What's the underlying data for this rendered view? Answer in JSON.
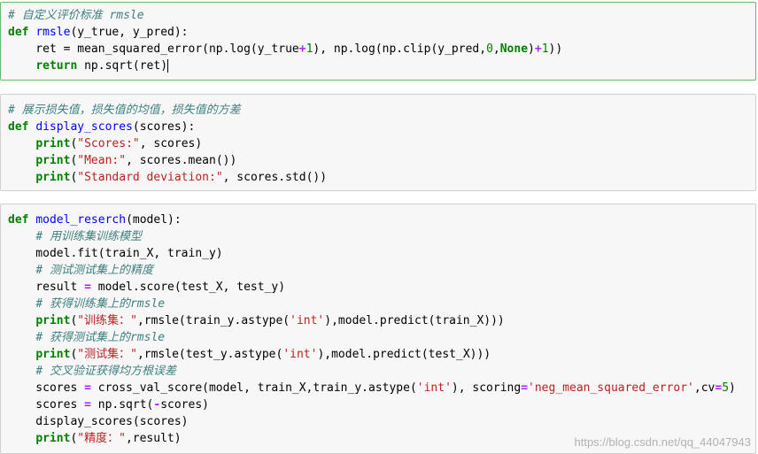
{
  "cells": [
    {
      "lines": [
        [
          {
            "t": "cm",
            "v": "# 自定义评价标准 rmsle"
          }
        ],
        [
          {
            "t": "kw",
            "v": "def"
          },
          {
            "t": "p",
            "v": " "
          },
          {
            "t": "def",
            "v": "rmsle"
          },
          {
            "t": "p",
            "v": "(y_true, y_pred):"
          }
        ],
        [
          {
            "t": "p",
            "v": "    ret = mean_squared_error(np.log(y_true"
          },
          {
            "t": "op",
            "v": "+"
          },
          {
            "t": "num",
            "v": "1"
          },
          {
            "t": "p",
            "v": "), np.log(np.clip(y_pred,"
          },
          {
            "t": "num",
            "v": "0"
          },
          {
            "t": "p",
            "v": ","
          },
          {
            "t": "kw",
            "v": "None"
          },
          {
            "t": "p",
            "v": ")"
          },
          {
            "t": "op",
            "v": "+"
          },
          {
            "t": "num",
            "v": "1"
          },
          {
            "t": "p",
            "v": "))"
          }
        ],
        [
          {
            "t": "p",
            "v": "    "
          },
          {
            "t": "kw",
            "v": "return"
          },
          {
            "t": "p",
            "v": " np.sqrt(ret)"
          }
        ]
      ]
    },
    {
      "lines": [
        [
          {
            "t": "cm",
            "v": "# 展示损失值，损失值的均值，损失值的方差"
          }
        ],
        [
          {
            "t": "kw",
            "v": "def"
          },
          {
            "t": "p",
            "v": " "
          },
          {
            "t": "def",
            "v": "display_scores"
          },
          {
            "t": "p",
            "v": "(scores):"
          }
        ],
        [
          {
            "t": "p",
            "v": "    "
          },
          {
            "t": "kw",
            "v": "print"
          },
          {
            "t": "p",
            "v": "("
          },
          {
            "t": "str",
            "v": "\"Scores:\""
          },
          {
            "t": "p",
            "v": ", scores)"
          }
        ],
        [
          {
            "t": "p",
            "v": "    "
          },
          {
            "t": "kw",
            "v": "print"
          },
          {
            "t": "p",
            "v": "("
          },
          {
            "t": "str",
            "v": "\"Mean:\""
          },
          {
            "t": "p",
            "v": ", scores.mean())"
          }
        ],
        [
          {
            "t": "p",
            "v": "    "
          },
          {
            "t": "kw",
            "v": "print"
          },
          {
            "t": "p",
            "v": "("
          },
          {
            "t": "str",
            "v": "\"Standard deviation:\""
          },
          {
            "t": "p",
            "v": ", scores.std())"
          }
        ]
      ]
    },
    {
      "lines": [
        [
          {
            "t": "kw",
            "v": "def"
          },
          {
            "t": "p",
            "v": " "
          },
          {
            "t": "def",
            "v": "model_reserch"
          },
          {
            "t": "p",
            "v": "(model):"
          }
        ],
        [
          {
            "t": "p",
            "v": "    "
          },
          {
            "t": "cm",
            "v": "# 用训练集训练模型"
          }
        ],
        [
          {
            "t": "p",
            "v": "    model.fit(train_X, train_y)"
          }
        ],
        [
          {
            "t": "p",
            "v": "    "
          },
          {
            "t": "cm",
            "v": "# 测试测试集上的精度"
          }
        ],
        [
          {
            "t": "p",
            "v": "    result "
          },
          {
            "t": "op",
            "v": "="
          },
          {
            "t": "p",
            "v": " model.score(test_X, test_y)"
          }
        ],
        [
          {
            "t": "p",
            "v": "    "
          },
          {
            "t": "cm",
            "v": "# 获得训练集上的rmsle"
          }
        ],
        [
          {
            "t": "p",
            "v": "    "
          },
          {
            "t": "kw",
            "v": "print"
          },
          {
            "t": "p",
            "v": "("
          },
          {
            "t": "str",
            "v": "\"训练集：\""
          },
          {
            "t": "p",
            "v": ",rmsle(train_y.astype("
          },
          {
            "t": "str",
            "v": "'int'"
          },
          {
            "t": "p",
            "v": "),model.predict(train_X)))"
          }
        ],
        [
          {
            "t": "p",
            "v": "    "
          },
          {
            "t": "cm",
            "v": "# 获得测试集上的rmsle"
          }
        ],
        [
          {
            "t": "p",
            "v": "    "
          },
          {
            "t": "kw",
            "v": "print"
          },
          {
            "t": "p",
            "v": "("
          },
          {
            "t": "str",
            "v": "\"测试集：\""
          },
          {
            "t": "p",
            "v": ",rmsle(test_y.astype("
          },
          {
            "t": "str",
            "v": "'int'"
          },
          {
            "t": "p",
            "v": "),model.predict(test_X)))"
          }
        ],
        [
          {
            "t": "p",
            "v": "    "
          },
          {
            "t": "cm",
            "v": "# 交叉验证获得均方根误差"
          }
        ],
        [
          {
            "t": "p",
            "v": "    scores "
          },
          {
            "t": "op",
            "v": "="
          },
          {
            "t": "p",
            "v": " cross_val_score(model, train_X,train_y.astype("
          },
          {
            "t": "str",
            "v": "'int'"
          },
          {
            "t": "p",
            "v": "), scoring"
          },
          {
            "t": "op",
            "v": "="
          },
          {
            "t": "str",
            "v": "'neg_mean_squared_error'"
          },
          {
            "t": "p",
            "v": ",cv"
          },
          {
            "t": "op",
            "v": "="
          },
          {
            "t": "num",
            "v": "5"
          },
          {
            "t": "p",
            "v": ")"
          }
        ],
        [
          {
            "t": "p",
            "v": "    scores "
          },
          {
            "t": "op",
            "v": "="
          },
          {
            "t": "p",
            "v": " np.sqrt("
          },
          {
            "t": "op",
            "v": "-"
          },
          {
            "t": "p",
            "v": "scores)"
          }
        ],
        [
          {
            "t": "p",
            "v": "    display_scores(scores)"
          }
        ],
        [
          {
            "t": "p",
            "v": "    "
          },
          {
            "t": "kw",
            "v": "print"
          },
          {
            "t": "p",
            "v": "("
          },
          {
            "t": "str",
            "v": "\"精度：\""
          },
          {
            "t": "p",
            "v": ",result)"
          }
        ]
      ]
    }
  ],
  "watermark": "https://blog.csdn.net/qq_44047943"
}
